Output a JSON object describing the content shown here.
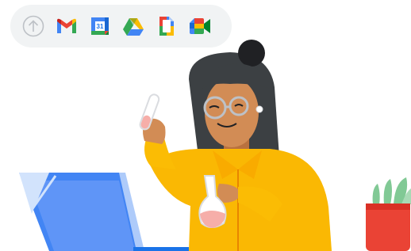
{
  "app_bar": {
    "items": [
      {
        "icon": "upload-arrow-icon"
      },
      {
        "icon": "gmail-icon"
      },
      {
        "icon": "calendar-icon",
        "label": "31"
      },
      {
        "icon": "drive-icon"
      },
      {
        "icon": "docs-icon"
      },
      {
        "icon": "meet-icon"
      }
    ]
  },
  "colors": {
    "blue": "#4285f4",
    "red": "#ea4335",
    "yellow": "#fbbc04",
    "green": "#34a853",
    "shirt": "#fbc02d",
    "skin": "#d28c55",
    "hair": "#3c4043",
    "pot": "#ea4335",
    "plant": "#81c995",
    "laptop": "#4285f4"
  }
}
